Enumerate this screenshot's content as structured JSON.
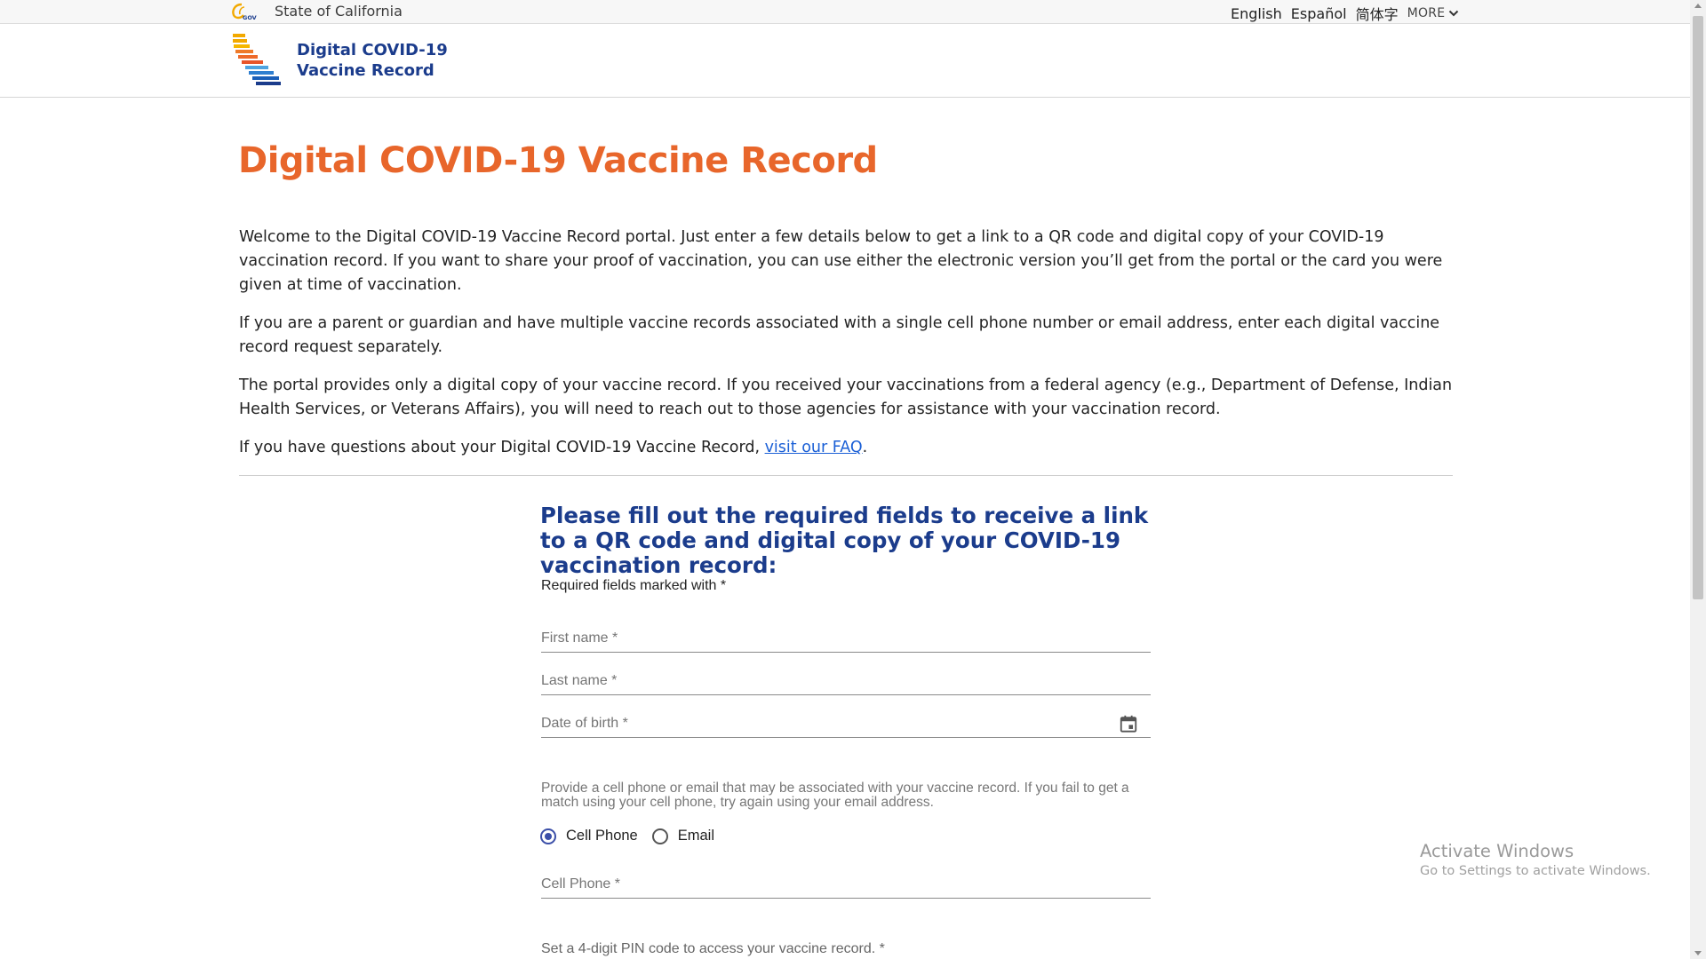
{
  "utility_bar": {
    "state_label": "State of California",
    "languages": [
      "English",
      "Español",
      "简体字"
    ],
    "more_label": "MORE"
  },
  "brand": {
    "title_line1": "Digital COVID-19",
    "title_line2": "Vaccine Record"
  },
  "main": {
    "page_title": "Digital COVID-19 Vaccine Record",
    "intro_paragraphs": [
      "Welcome to the Digital COVID-19 Vaccine Record portal. Just enter a few details below to get a link to a QR code and digital copy of your COVID-19 vaccination record. If you want to share your proof of vaccination, you can use either the electronic version you’ll get from the portal or the card you were given at time of vaccination.",
      "If you are a parent or guardian and have multiple vaccine records associated with a single cell phone number or email address, enter each digital vaccine record request separately.",
      "The portal provides only a digital copy of your vaccine record. If you received your vaccinations from a federal agency (e.g., Department of Defense, Indian Health Services, or Veterans Affairs), you will need to reach out to those agencies for assistance with your vaccination record."
    ],
    "faq_prefix": "If you have questions about your Digital COVID-19 Vaccine Record, ",
    "faq_link": "visit our FAQ",
    "faq_suffix": "."
  },
  "form": {
    "heading": "Please fill out the required fields to receive a link to a QR code and digital copy of your COVID-19 vaccination record:",
    "required_note": "Required fields marked with *",
    "first_name_label": "First name *",
    "last_name_label": "Last name *",
    "dob_label": "Date of birth *",
    "contact_help": "Provide a cell phone or email that may be associated with your vaccine record. If you fail to get a match using your cell phone, try again using your email address.",
    "contact_options": [
      {
        "label": "Cell Phone",
        "selected": true
      },
      {
        "label": "Email",
        "selected": false
      }
    ],
    "cell_phone_label": "Cell Phone *",
    "pin_label": "Set a 4-digit PIN code to access your vaccine record. *"
  },
  "watermark": {
    "title": "Activate Windows",
    "subtitle": "Go to Settings to activate Windows."
  },
  "colors": {
    "title_orange": "#e8662b",
    "brand_blue": "#1b3c8c",
    "link_blue": "#1a5fd6",
    "radio_blue": "#3b4fa8"
  }
}
